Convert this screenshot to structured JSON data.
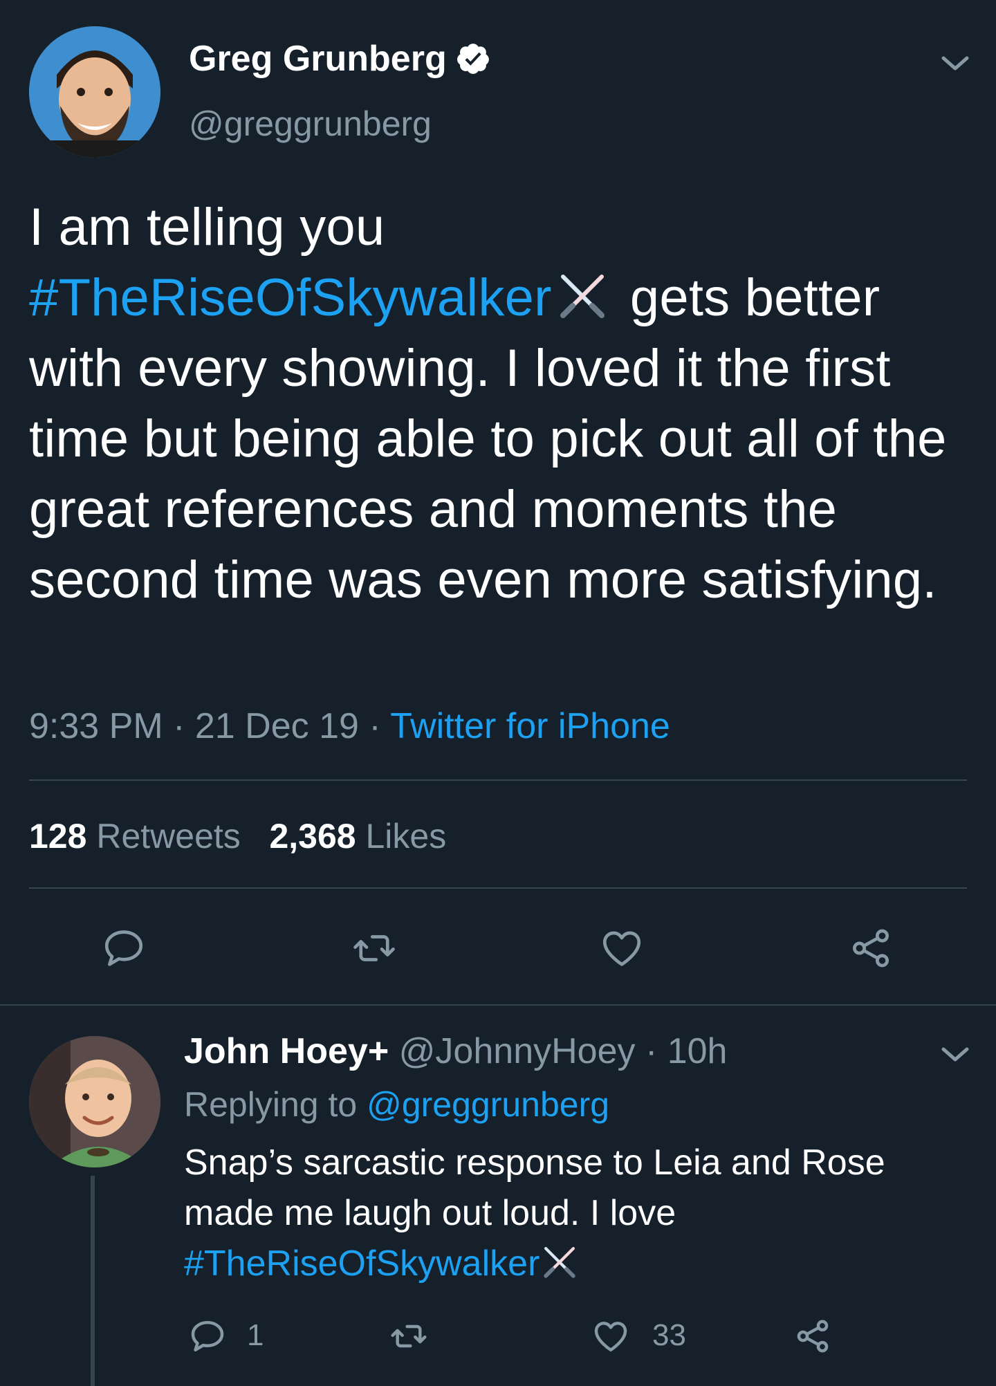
{
  "main_tweet": {
    "author_name": "Greg Grunberg",
    "handle": "@greggrunberg",
    "text_part1": "I am telling you",
    "hashtag": "#TheRiseOfSkywalker",
    "text_part2": " gets better with every showing. I loved it the first time but being able to pick out all of the great references and moments the second time was even more satisfying.",
    "time": "9:33 PM",
    "date": "21 Dec 19",
    "source": "Twitter for iPhone",
    "retweets_count": "128",
    "retweets_label": "Retweets",
    "likes_count": "2,368",
    "likes_label": "Likes"
  },
  "reply": {
    "author_name": "John Hoey+",
    "handle": "@JohnnyHoey",
    "age": "10h",
    "replying_to_label": "Replying to",
    "replying_to_handle": "@greggrunberg",
    "text": "Snap’s sarcastic response to Leia and Rose made me laugh out loud. I love",
    "hashtag": "#TheRiseOfSkywalker",
    "reply_count": "1",
    "like_count": "33"
  },
  "separators": {
    "dot": " · "
  },
  "icons": [
    "verified-badge-icon",
    "chevron-down-icon",
    "reply-icon",
    "retweet-icon",
    "like-icon",
    "share-icon",
    "lightsaber-emoji-icon"
  ],
  "colors": {
    "background": "#15202b",
    "link": "#1da1f2",
    "secondary_text": "#8899a6",
    "divider": "#38444d"
  }
}
